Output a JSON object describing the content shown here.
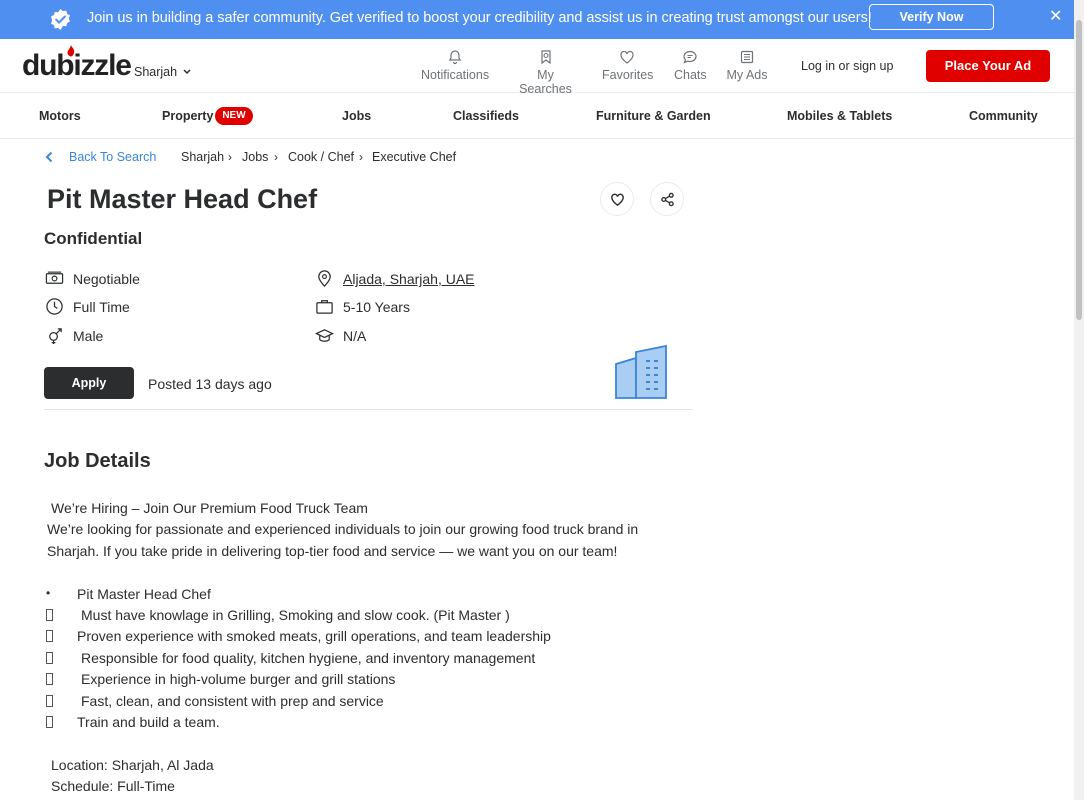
{
  "banner": {
    "text": "Join us in building a safer community. Get verified to boost your credibility and assist us in creating trust amongst our users!",
    "verify_label": "Verify Now",
    "close": "✕"
  },
  "header": {
    "logo": "dubizzle",
    "city": "Sharjah",
    "nav": {
      "notifications": "Notifications",
      "searches": "My Searches",
      "favorites": "Favorites",
      "chats": "Chats",
      "ads": "My Ads"
    },
    "login": "Log in or sign up",
    "place_ad": "Place Your Ad"
  },
  "categories": {
    "motors": "Motors",
    "property": "Property",
    "new_badge": "NEW",
    "jobs": "Jobs",
    "classifieds": "Classifieds",
    "furniture": "Furniture & Garden",
    "mobiles": "Mobiles & Tablets",
    "community": "Community"
  },
  "breadcrumb": {
    "back": "Back To Search",
    "sep": "›",
    "items": [
      "Sharjah",
      "Jobs",
      "Cook / Chef",
      "Executive Chef"
    ]
  },
  "job": {
    "title": "Pit Master Head Chef",
    "company": "Confidential",
    "salary": "Negotiable",
    "location": "Aljada, Sharjah, UAE",
    "type": "Full Time",
    "experience": "5-10 Years",
    "gender": "Male",
    "education": "N/A",
    "apply_label": "Apply",
    "posted": "Posted 13 days ago"
  },
  "details": {
    "heading": "Job Details",
    "intro1": "We’re Hiring – Join Our Premium Food Truck Team",
    "intro2": "We’re looking for passionate and experienced individuals to join our growing food truck brand in",
    "intro3": "Sharjah. If you take pride in delivering top-tier food and service — we want you on our team!",
    "bullet_char": "•",
    "items": [
      "Pit Master Head Chef",
      "Must have knowlage in Grilling, Smoking and slow cook. (Pit Master )",
      "Proven experience with smoked meats, grill operations, and team leadership",
      "Responsible for food quality, kitchen hygiene, and inventory management",
      "Experience in high-volume burger and grill stations",
      "Fast, clean, and consistent with prep and service",
      "Train and build a team."
    ],
    "location_line": "Location: Sharjah, Al Jada",
    "schedule_line": "Schedule: Full-Time"
  },
  "colors": {
    "banner": "#4f8ff0",
    "accent_red": "#e00000",
    "link_blue": "#3a86d8",
    "dark": "#2b2d2e"
  }
}
